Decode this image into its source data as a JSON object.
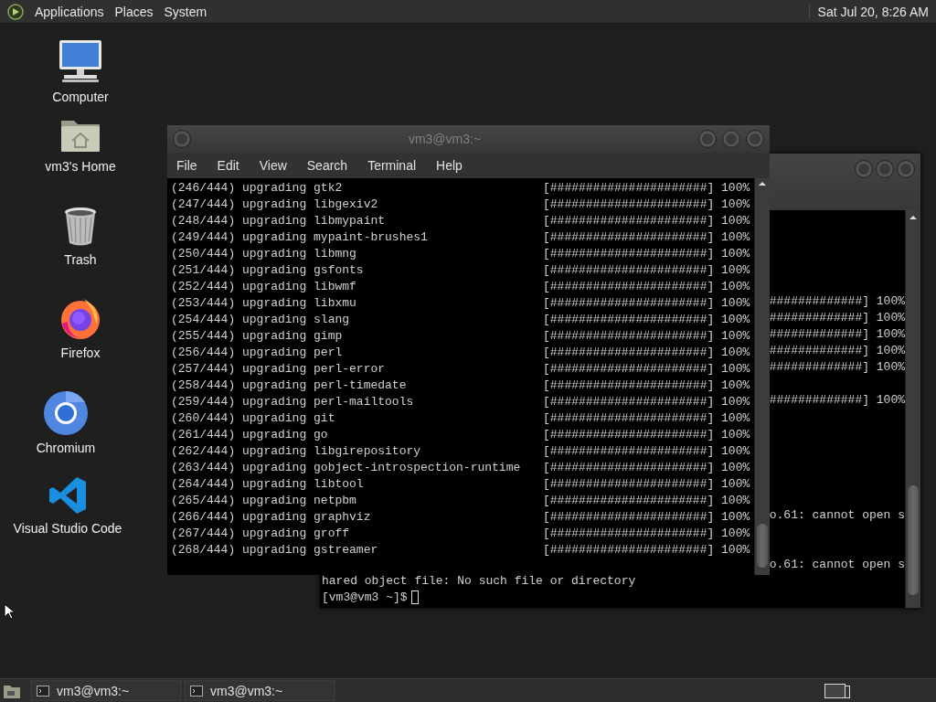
{
  "top_panel": {
    "menus": [
      "Applications",
      "Places",
      "System"
    ],
    "clock": "Sat Jul 20,  8:26 AM"
  },
  "desktop_icons": [
    {
      "kind": "computer",
      "label": "Computer"
    },
    {
      "kind": "home",
      "label": "vm3's Home"
    },
    {
      "kind": "trash",
      "label": "Trash"
    },
    {
      "kind": "firefox",
      "label": "Firefox"
    },
    {
      "kind": "chromium",
      "label": "Chromium"
    },
    {
      "kind": "vscode",
      "label": "Visual Studio Code"
    }
  ],
  "back_window": {
    "lines": [
      {
        "kind": "tail",
        "text": "#############] 100%"
      },
      {
        "kind": "tail",
        "text": "#############] 100%"
      },
      {
        "kind": "tail",
        "text": "#############] 100%"
      },
      {
        "kind": "tail",
        "text": "#############] 100%"
      },
      {
        "kind": "tail",
        "text": "#############] 100%"
      },
      {
        "kind": "tail",
        "text": "#############] 100%"
      },
      {
        "kind": "tail",
        "text": "o.61: cannot open s"
      },
      {
        "kind": "tail",
        "text": "o.61: cannot open s"
      },
      {
        "kind": "full",
        "text": "hared object file: No such file or directory"
      },
      {
        "kind": "prompt",
        "text": "[vm3@vm3 ~]$",
        "cursor": true
      }
    ]
  },
  "front_window": {
    "title": "vm3@vm3:~",
    "menus": [
      "File",
      "Edit",
      "View",
      "Search",
      "Terminal",
      "Help"
    ],
    "lines": [
      {
        "text": "(246/444) upgrading gtk2",
        "progress": "[######################] 100%"
      },
      {
        "text": "(247/444) upgrading libgexiv2",
        "progress": "[######################] 100%"
      },
      {
        "text": "(248/444) upgrading libmypaint",
        "progress": "[######################] 100%"
      },
      {
        "text": "(249/444) upgrading mypaint-brushes1",
        "progress": "[######################] 100%"
      },
      {
        "text": "(250/444) upgrading libmng",
        "progress": "[######################] 100%"
      },
      {
        "text": "(251/444) upgrading gsfonts",
        "progress": "[######################] 100%"
      },
      {
        "text": "(252/444) upgrading libwmf",
        "progress": "[######################] 100%"
      },
      {
        "text": "(253/444) upgrading libxmu",
        "progress": "[######################] 100%"
      },
      {
        "text": "(254/444) upgrading slang",
        "progress": "[######################] 100%"
      },
      {
        "text": "(255/444) upgrading gimp",
        "progress": "[######################] 100%"
      },
      {
        "text": "(256/444) upgrading perl",
        "progress": "[######################] 100%"
      },
      {
        "text": "(257/444) upgrading perl-error",
        "progress": "[######################] 100%"
      },
      {
        "text": "(258/444) upgrading perl-timedate",
        "progress": "[######################] 100%"
      },
      {
        "text": "(259/444) upgrading perl-mailtools",
        "progress": "[######################] 100%"
      },
      {
        "text": "(260/444) upgrading git",
        "progress": "[######################] 100%"
      },
      {
        "text": "(261/444) upgrading go",
        "progress": "[######################] 100%"
      },
      {
        "text": "(262/444) upgrading libgirepository",
        "progress": "[######################] 100%"
      },
      {
        "text": "(263/444) upgrading gobject-introspection-runtime",
        "progress": "[######################] 100%"
      },
      {
        "text": "(264/444) upgrading libtool",
        "progress": "[######################] 100%"
      },
      {
        "text": "(265/444) upgrading netpbm",
        "progress": "[######################] 100%"
      },
      {
        "text": "(266/444) upgrading graphviz",
        "progress": "[######################] 100%"
      },
      {
        "text": "(267/444) upgrading groff",
        "progress": "[######################] 100%"
      },
      {
        "text": "(268/444) upgrading gstreamer",
        "progress": "[######################] 100%"
      }
    ]
  },
  "taskbar": {
    "tasks": [
      "vm3@vm3:~",
      "vm3@vm3:~"
    ]
  }
}
